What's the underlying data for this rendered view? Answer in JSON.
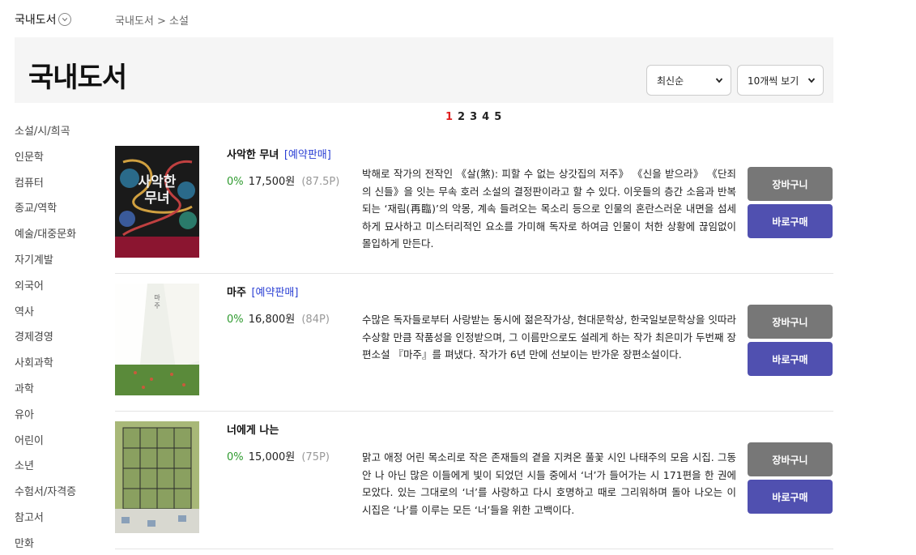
{
  "top_category": "국내도서",
  "breadcrumb": "국내도서 > 소설",
  "header": {
    "title": "국내도서",
    "sort_select": "최신순",
    "count_select": "10개씩 보기"
  },
  "sidebar": {
    "items": [
      {
        "label": "소설/시/희곡"
      },
      {
        "label": "인문학"
      },
      {
        "label": "컴퓨터"
      },
      {
        "label": "종교/역학"
      },
      {
        "label": "예술/대중문화"
      },
      {
        "label": "자기계발"
      },
      {
        "label": "외국어"
      },
      {
        "label": "역사"
      },
      {
        "label": "경제경영"
      },
      {
        "label": "사회과학"
      },
      {
        "label": "과학"
      },
      {
        "label": "유아"
      },
      {
        "label": "어린이"
      },
      {
        "label": "소년"
      },
      {
        "label": "수험서/자격증"
      },
      {
        "label": "참고서"
      },
      {
        "label": "만화"
      }
    ]
  },
  "pagination": {
    "pages": [
      "1",
      "2",
      "3",
      "4",
      "5"
    ],
    "current": "1"
  },
  "books": [
    {
      "title": "사악한 무녀",
      "presale_badge": "[예약판매]",
      "discount": "0%",
      "price": "17,500원",
      "points": "(87.5P)",
      "description": "박해로 작가의 전작인 《살(煞): 피할 수 없는 상갓집의 저주》 《신을 받으라》 《단죄의 신들》을 잇는 무속 호러 소설의 결정판이라고 할 수 있다. 이웃들의 층간 소음과 반복되는 ‘재림(再臨)’의 악몽, 계속 들려오는 목소리 등으로 인물의 혼란스러운 내면을 섬세하게 묘사하고 미스터리적인 요소를 가미해 독자로 하여금 인물이 처한 상황에 끊임없이 몰입하게 만든다.",
      "cart_label": "장바구니",
      "buy_label": "바로구매",
      "cover_title": "사악한 무녀",
      "cover_colors": {
        "bg": "#1a1a1a",
        "band": "#8b1530",
        "accent": "#2a7a6a"
      }
    },
    {
      "title": "마주",
      "presale_badge": "[예약판매]",
      "discount": "0%",
      "price": "16,800원",
      "points": "(84P)",
      "description": "수많은 독자들로부터 사랑받는 동시에 젊은작가상, 현대문학상, 한국일보문학상을 잇따라 수상할 만큼 작품성을 인정받으며, 그 이름만으로도 설레게 하는 작가 최은미가 두번째 장편소설 『마주』를 펴냈다. 작가가 6년 만에 선보이는 반가운 장편소설이다.",
      "cart_label": "장바구니",
      "buy_label": "바로구매",
      "cover_title": "마주",
      "cover_colors": {
        "bg": "#e8ece6",
        "band": "#5a8a3a",
        "accent": "#c85a3a"
      }
    },
    {
      "title": "너에게 나는",
      "presale_badge": "",
      "discount": "0%",
      "price": "15,000원",
      "points": "(75P)",
      "description": "맑고 애정 어린 목소리로 작은 존재들의 곁을 지켜온 풀꽃 시인 나태주의 모음 시집. 그동안 나 아닌 많은 이들에게 빛이 되었던 시들 중에서 ‘너’가 들어가는 시 171편을 한 권에 모았다. 있는 그대로의 ‘너’를 사랑하고 다시 호명하고 때로 그리워하며 돌아 나오는 이 시집은 ‘나’를 이루는 모든 ‘너’들을 위한 고백이다.",
      "cart_label": "장바구니",
      "buy_label": "바로구매",
      "cover_title": "",
      "cover_colors": {
        "bg": "#a8b878",
        "band": "#6a8040",
        "accent": "#d8d8d0"
      }
    }
  ]
}
